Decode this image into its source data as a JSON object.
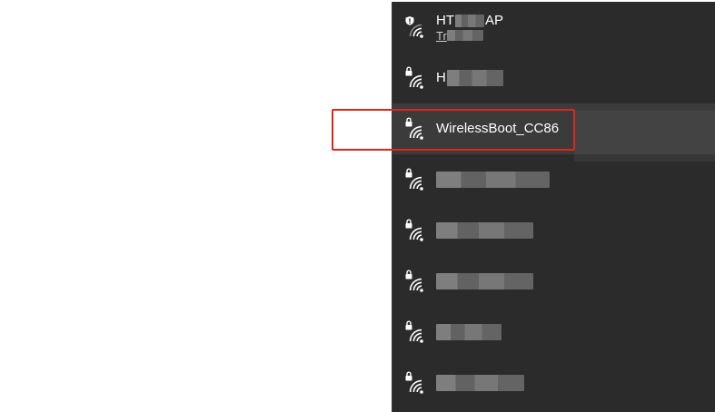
{
  "networks": [
    {
      "ssid_visible": "HT",
      "ssid_tail": "AP",
      "subtitle_visible": "Tr",
      "secured": true,
      "shield": true,
      "redacted": true
    },
    {
      "ssid_visible": "H",
      "secured": true,
      "redacted": true
    },
    {
      "ssid_visible": "WirelessBoot_CC86",
      "secured": true,
      "redacted": false,
      "selected": true
    },
    {
      "ssid_visible": "",
      "secured": true,
      "redacted": true
    },
    {
      "ssid_visible": "",
      "secured": true,
      "redacted": true
    },
    {
      "ssid_visible": "",
      "secured": true,
      "redacted": true
    },
    {
      "ssid_visible": "",
      "secured": true,
      "redacted": true
    },
    {
      "ssid_visible": "",
      "secured": true,
      "redacted": true
    }
  ],
  "icons": {
    "wifi": "wifi-signal-icon",
    "lock": "lock-icon",
    "shield": "shield-warning-icon"
  },
  "colors": {
    "flyout_bg": "#2b2b2b",
    "selected_bg": "#3b3b3b",
    "highlight": "#e0251b",
    "text": "#ffffff"
  }
}
